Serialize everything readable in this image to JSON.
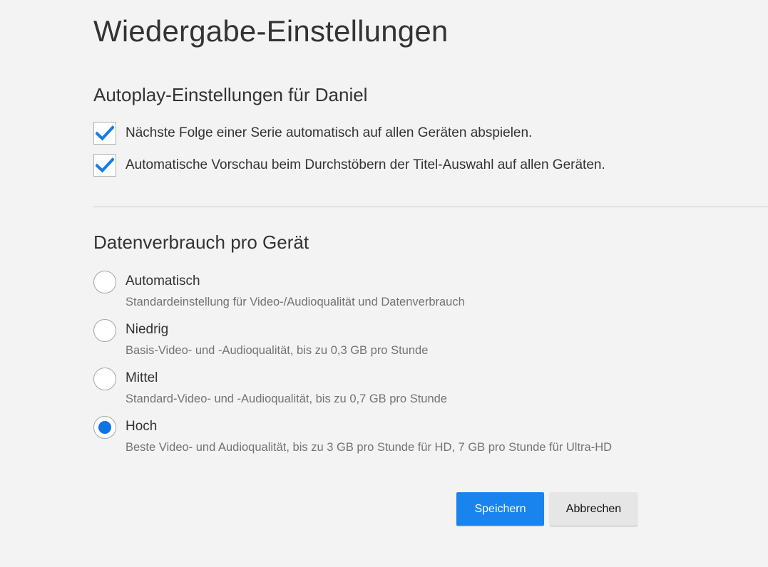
{
  "page": {
    "title": "Wiedergabe-Einstellungen"
  },
  "autoplay": {
    "title": "Autoplay-Einstellungen für Daniel",
    "options": [
      {
        "label": "Nächste Folge einer Serie automatisch auf allen Geräten abspielen.",
        "checked": true,
        "icon": "checkmark-icon"
      },
      {
        "label": "Automatische Vorschau beim Durchstöbern der Titel-Auswahl auf allen Geräten.",
        "checked": true,
        "icon": "checkmark-icon"
      }
    ]
  },
  "data_usage": {
    "title": "Datenverbrauch pro Gerät",
    "options": [
      {
        "label": "Automatisch",
        "description": "Standardeinstellung für Video-/Audioqualität und Datenverbrauch",
        "selected": false
      },
      {
        "label": "Niedrig",
        "description": "Basis-Video- und -Audioqualität, bis zu 0,3 GB pro Stunde",
        "selected": false
      },
      {
        "label": "Mittel",
        "description": "Standard-Video- und -Audioqualität, bis zu 0,7 GB pro Stunde",
        "selected": false
      },
      {
        "label": "Hoch",
        "description": "Beste Video- und Audioqualität, bis zu 3 GB pro Stunde für HD, 7 GB pro Stunde für Ultra-HD",
        "selected": true
      }
    ]
  },
  "actions": {
    "save_label": "Speichern",
    "cancel_label": "Abbrechen"
  },
  "colors": {
    "accent": "#0f73e6",
    "save_button": "#1a84ee",
    "cancel_button": "#e6e6e6",
    "background": "#f3f3f3",
    "checkmark": "#1a7ee6"
  }
}
